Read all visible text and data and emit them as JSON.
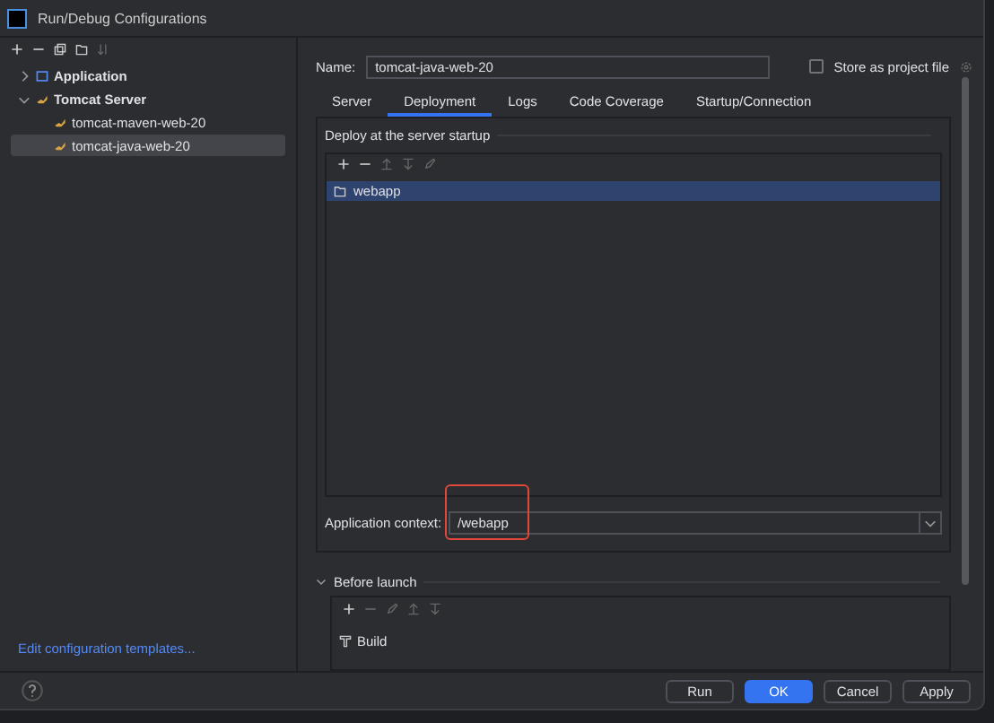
{
  "window": {
    "title": "Run/Debug Configurations"
  },
  "sidebar": {
    "items": [
      {
        "label": "Application",
        "kind": "app",
        "expanded": false,
        "selected": false
      },
      {
        "label": "Tomcat Server",
        "kind": "tomcat",
        "expanded": true,
        "selected": false,
        "children": [
          {
            "label": "tomcat-maven-web-20",
            "kind": "tomcat",
            "selected": false
          },
          {
            "label": "tomcat-java-web-20",
            "kind": "tomcat",
            "selected": true
          }
        ]
      }
    ],
    "templates_link": "Edit configuration templates..."
  },
  "name_field": {
    "label": "Name:",
    "value": "tomcat-java-web-20"
  },
  "store_as_project_file": {
    "label": "Store as project file",
    "checked": false
  },
  "tabs": [
    {
      "label": "Server",
      "selected": false
    },
    {
      "label": "Deployment",
      "selected": true
    },
    {
      "label": "Logs",
      "selected": false
    },
    {
      "label": "Code Coverage",
      "selected": false
    },
    {
      "label": "Startup/Connection",
      "selected": false
    }
  ],
  "deployment": {
    "heading": "Deploy at the server startup",
    "items": [
      {
        "label": "webapp",
        "selected": true
      }
    ],
    "context": {
      "label": "Application context:",
      "value": "/webapp"
    }
  },
  "before_launch": {
    "heading": "Before launch",
    "expanded": true,
    "tasks": [
      {
        "label": "Build"
      }
    ]
  },
  "buttons": [
    {
      "label": "Run",
      "primary": false
    },
    {
      "label": "OK",
      "primary": true
    },
    {
      "label": "Cancel",
      "primary": false
    },
    {
      "label": "Apply",
      "primary": false
    }
  ]
}
